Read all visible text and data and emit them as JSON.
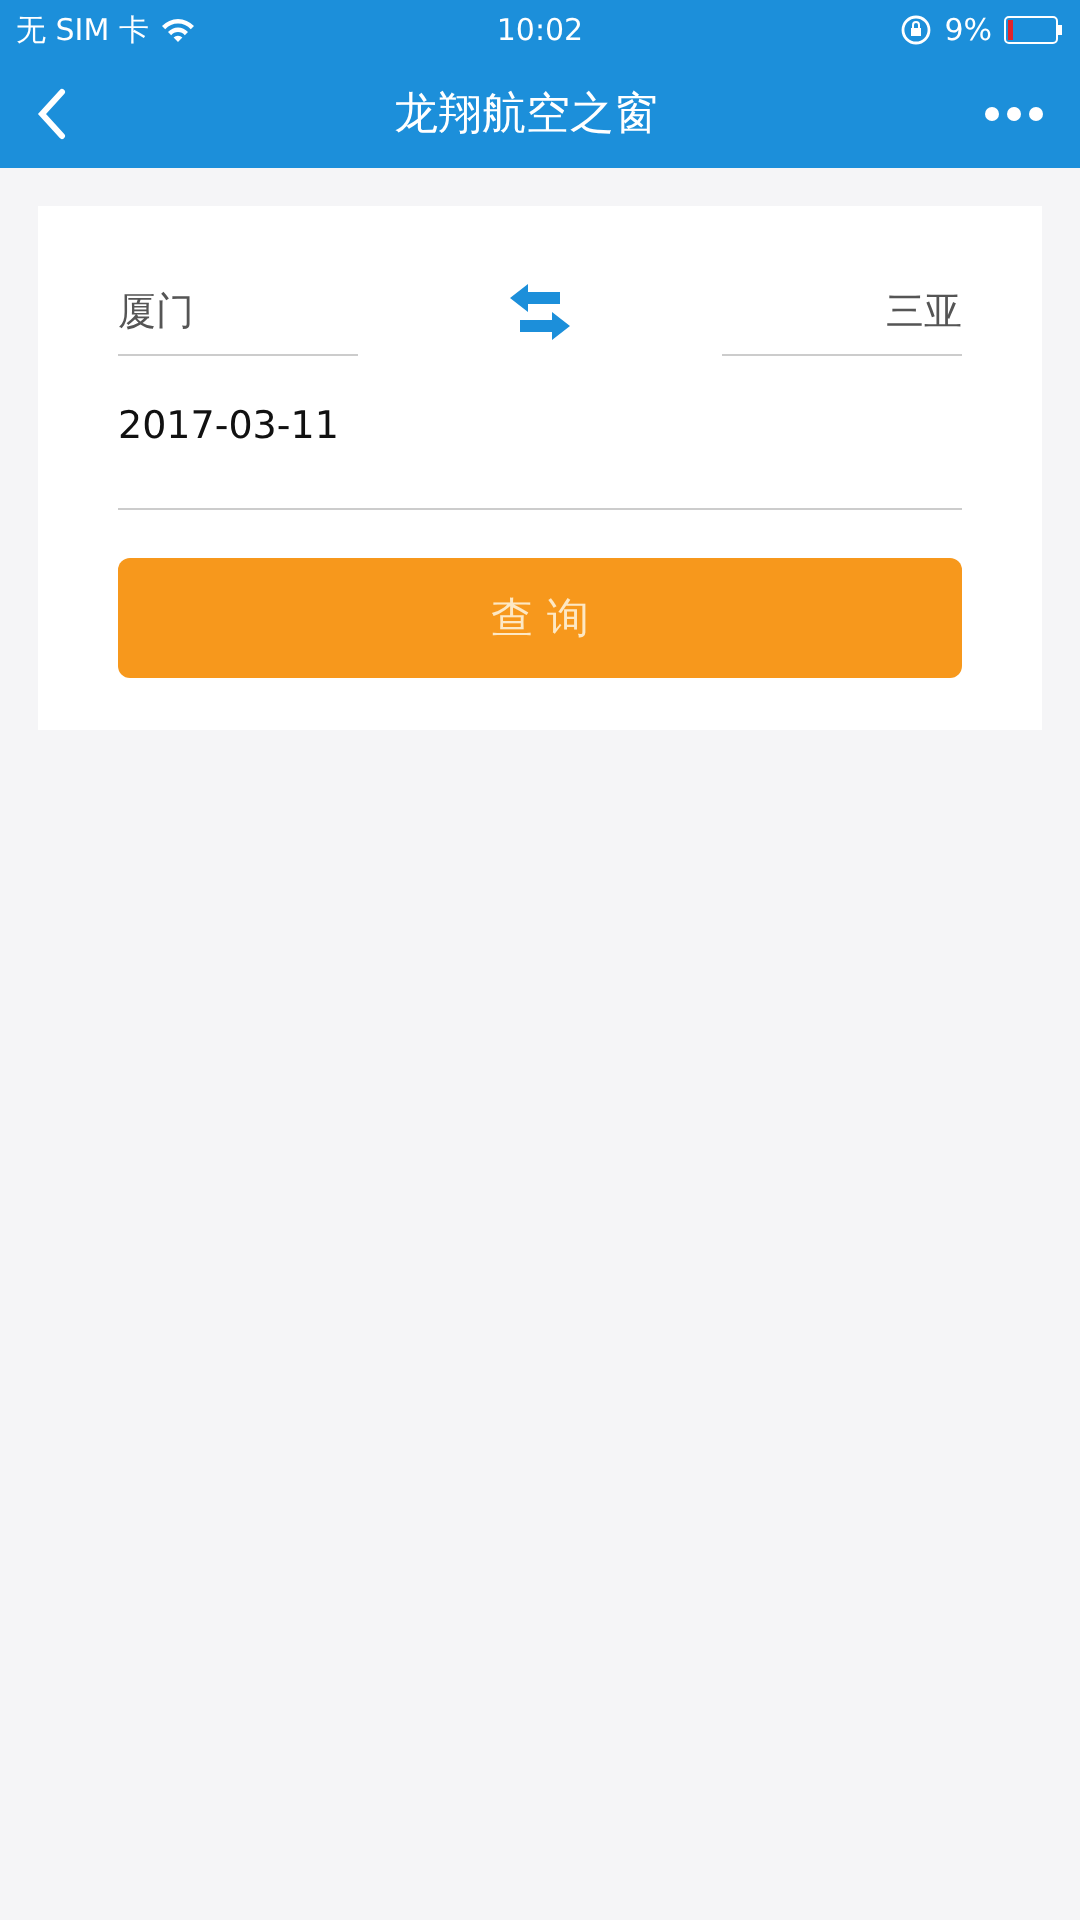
{
  "status_bar": {
    "carrier": "无 SIM 卡",
    "time": "10:02",
    "battery": "9%"
  },
  "nav_bar": {
    "title": "龙翔航空之窗"
  },
  "form": {
    "from_city": "厦门",
    "to_city": "三亚",
    "date": "2017-03-11",
    "search_button": "查 询"
  }
}
